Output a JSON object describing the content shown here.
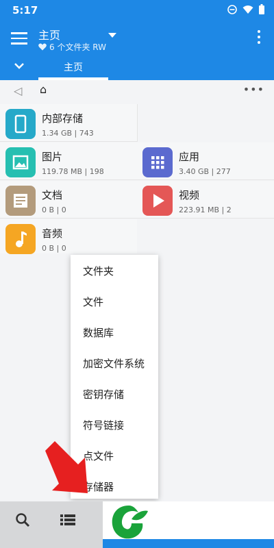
{
  "status": {
    "time": "5:17"
  },
  "appbar": {
    "title": "主页",
    "subtitle": "6 个文件夹 RW"
  },
  "tabs": [
    {
      "label": "主页",
      "active": true
    }
  ],
  "crumb": {
    "home_symbol": "⌂"
  },
  "storage_tiles": [
    {
      "name": "内部存储",
      "info": "1.34 GB | 743",
      "icon": "phone-icon",
      "color": "#26a9c9"
    },
    {
      "name": "图片",
      "info": "119.78 MB | 198",
      "icon": "image-icon",
      "color": "#26bfb1"
    },
    {
      "name": "应用",
      "info": "3.40 GB | 277",
      "icon": "apps-grid-icon",
      "color": "#5b6acf"
    },
    {
      "name": "文档",
      "info": "0 B | 0",
      "icon": "document-icon",
      "color": "#b39b7c"
    },
    {
      "name": "视频",
      "info": "223.91 MB | 2",
      "icon": "play-icon",
      "color": "#e45756"
    },
    {
      "name": "音频",
      "info": "0 B | 0",
      "icon": "music-note-icon",
      "color": "#f5a623"
    }
  ],
  "menu": {
    "items": [
      "文件夹",
      "文件",
      "数据库",
      "加密文件系统",
      "密钥存储",
      "符号链接",
      "点文件",
      "存储器"
    ]
  },
  "colors": {
    "primary": "#1e88e5",
    "arrow": "#e62020"
  }
}
